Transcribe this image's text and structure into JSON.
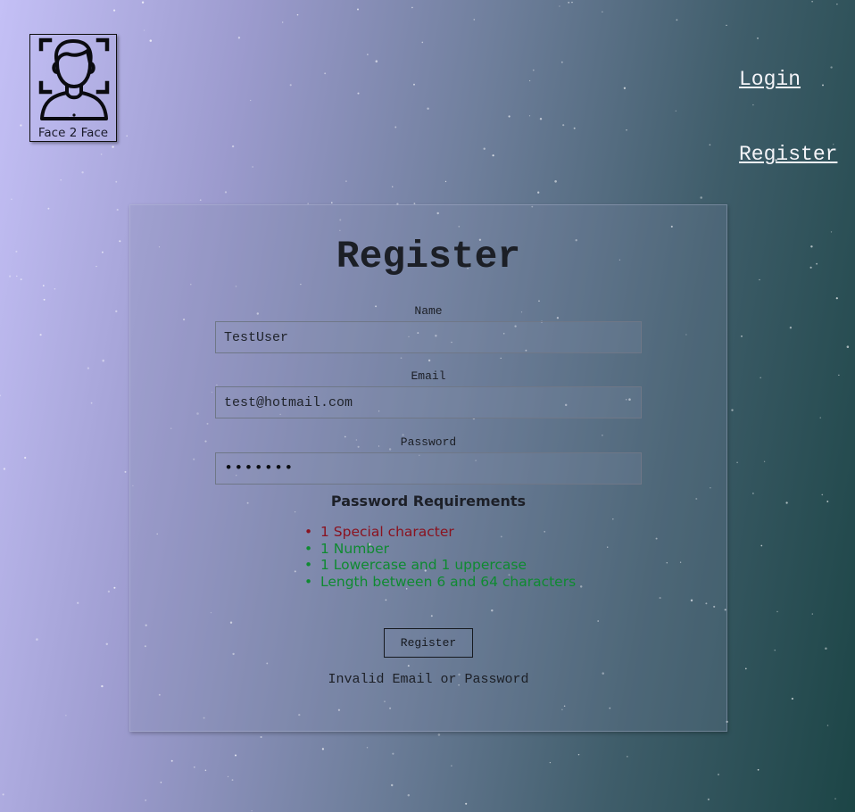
{
  "logo": {
    "text": "Face 2 Face",
    "icon": "face-scan-icon"
  },
  "nav": {
    "login": "Login",
    "register": "Register"
  },
  "form": {
    "title": "Register",
    "name": {
      "label": "Name",
      "value": "TestUser"
    },
    "email": {
      "label": "Email",
      "value": "test@hotmail.com"
    },
    "password": {
      "label": "Password",
      "value": "•••••••"
    },
    "requirements": {
      "title": "Password Requirements",
      "items": [
        {
          "text": "1 Special character",
          "status": "fail"
        },
        {
          "text": "1 Number",
          "status": "pass"
        },
        {
          "text": "1 Lowercase and 1 uppercase",
          "status": "pass"
        },
        {
          "text": "Length between 6 and 64 characters",
          "status": "pass"
        }
      ]
    },
    "submit_label": "Register",
    "error_message": "Invalid Email or Password"
  },
  "colors": {
    "requirement_fail": "#8a1320",
    "requirement_pass": "#0f8a31",
    "nav_link": "#f4f4f8"
  }
}
